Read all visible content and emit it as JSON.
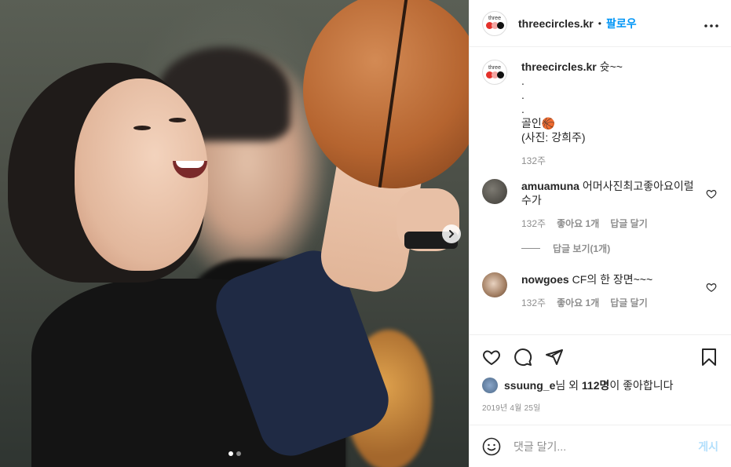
{
  "post": {
    "username": "threecircles.kr",
    "follow_label": "팔로우",
    "separator": "•",
    "more_label": "•••",
    "avatar_text": "three"
  },
  "caption": {
    "username": "threecircles.kr",
    "text_line1": "슛~~",
    "dots": [
      ".",
      ".",
      "."
    ],
    "text_line2": "골인🏀",
    "text_line3": "(사진: 강희주)",
    "time": "132주"
  },
  "comments": [
    {
      "username": "amuamuna",
      "text": "어머사진최고좋아요이럴수가",
      "time": "132주",
      "likes": "좋아요 1개",
      "reply": "답글 달기",
      "view_replies": "답글 보기(1개)"
    },
    {
      "username": "nowgoes",
      "text": "CF의 한 장면~~~",
      "time": "132주",
      "likes": "좋아요 1개",
      "reply": "답글 달기"
    }
  ],
  "likes": {
    "user": "ssuung_e",
    "suffix_1": "님 외 ",
    "count": "112명",
    "suffix_2": "이 좋아합니다"
  },
  "date": "2019년 4월 25일",
  "add_comment": {
    "placeholder": "댓글 달기...",
    "post_label": "게시"
  },
  "colors": {
    "accent": "#0095f6",
    "post_disabled": "#b2dffc",
    "meta": "#8e8e8e"
  },
  "carousel": {
    "index": 1,
    "total": 2
  },
  "icons": [
    "heart-icon",
    "comment-icon",
    "share-icon",
    "bookmark-icon",
    "emoji-icon",
    "chevron-right-icon",
    "more-icon"
  ]
}
